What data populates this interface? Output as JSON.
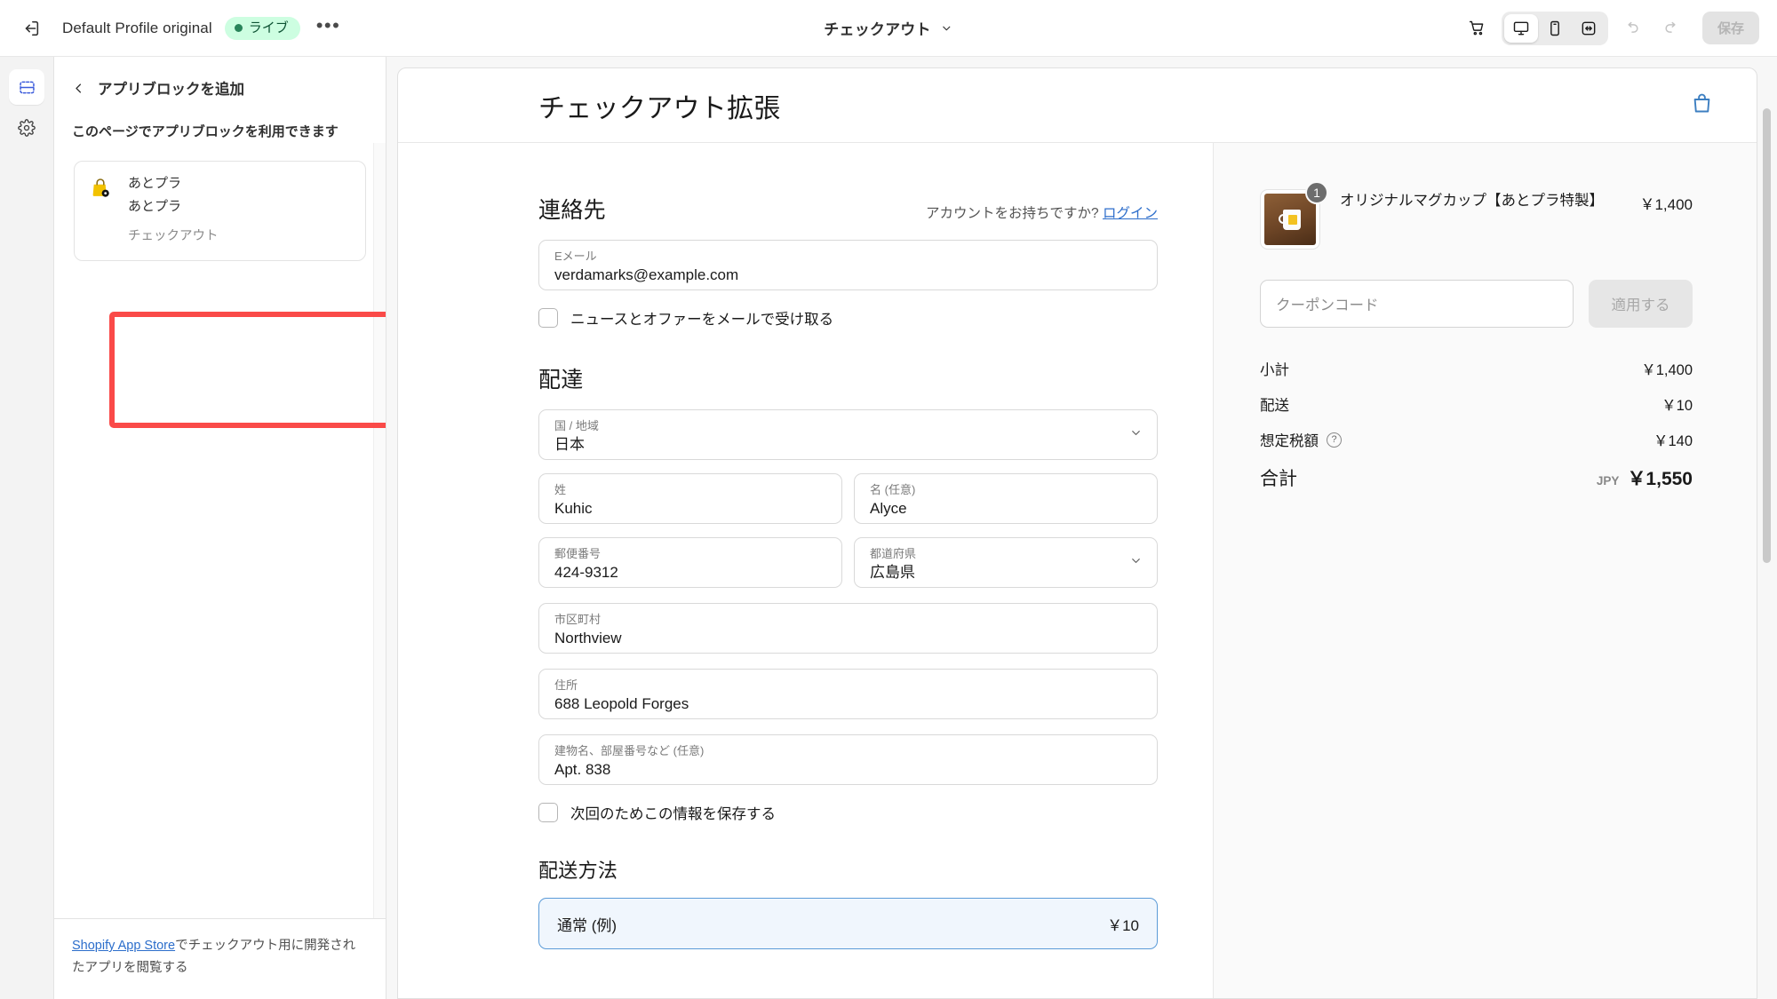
{
  "topbar": {
    "exit_icon": "exit-icon",
    "profile_name": "Default Profile original",
    "status_badge": "ライブ",
    "more_label": "•••",
    "center_title": "チェックアウト",
    "cart_icon": "cart-icon",
    "desktop_icon": "desktop-icon",
    "mobile_icon": "mobile-icon",
    "fullwidth_icon": "fullwidth-icon",
    "undo_icon": "undo-icon",
    "redo_icon": "redo-icon",
    "save_label": "保存"
  },
  "rail": {
    "sections_icon": "sections-icon",
    "settings_icon": "gear-icon"
  },
  "sidebar": {
    "back_icon": "chevron-left-icon",
    "title": "アプリブロックを追加",
    "subtitle": "このページでアプリブロックを利用できます",
    "blocks": [
      {
        "icon": "app-bag-icon",
        "name": "あとプラ",
        "app": "あとプラ",
        "scope": "チェックアウト"
      }
    ],
    "footer_link": "Shopify App Store",
    "footer_text": "でチェックアウト用に開発されたアプリを閲覧する"
  },
  "preview": {
    "shop_title": "チェックアウト拡張",
    "bag_icon": "shopping-bag-icon",
    "contact": {
      "title": "連絡先",
      "account_prompt": "アカウントをお持ちですか?",
      "login_link": "ログイン",
      "email_label": "Eメール",
      "email_value": "verdamarks@example.com",
      "newsletter_label": "ニュースとオファーをメールで受け取る"
    },
    "delivery": {
      "title": "配達",
      "country_label": "国 / 地域",
      "country_value": "日本",
      "last_name_label": "姓",
      "last_name_value": "Kuhic",
      "first_name_label": "名 (任意)",
      "first_name_value": "Alyce",
      "postal_label": "郵便番号",
      "postal_value": "424-9312",
      "prefecture_label": "都道府県",
      "prefecture_value": "広島県",
      "city_label": "市区町村",
      "city_value": "Northview",
      "address_label": "住所",
      "address_value": "688 Leopold Forges",
      "apt_label": "建物名、部屋番号など (任意)",
      "apt_value": "Apt. 838",
      "save_info_label": "次回のためこの情報を保存する"
    },
    "shipping": {
      "title": "配送方法",
      "option_name": "通常 (例)",
      "option_price": "￥10"
    },
    "summary": {
      "product_name": "オリジナルマグカップ【あとプラ特製】",
      "product_qty": "1",
      "product_price": "￥1,400",
      "coupon_placeholder": "クーポンコード",
      "coupon_button": "適用する",
      "rows": [
        {
          "label": "小計",
          "value": "￥1,400"
        },
        {
          "label": "配送",
          "value": "￥10"
        },
        {
          "label": "想定税額",
          "value": "￥140",
          "info": "?"
        }
      ],
      "total_label": "合計",
      "total_currency": "JPY",
      "total_value": "￥1,550"
    }
  },
  "colors": {
    "highlight": "#fa4a48",
    "link": "#2c6ecb",
    "live_bg": "#cdfee1",
    "live_fg": "#0c5132",
    "accent_blue": "#3d7fc1"
  }
}
